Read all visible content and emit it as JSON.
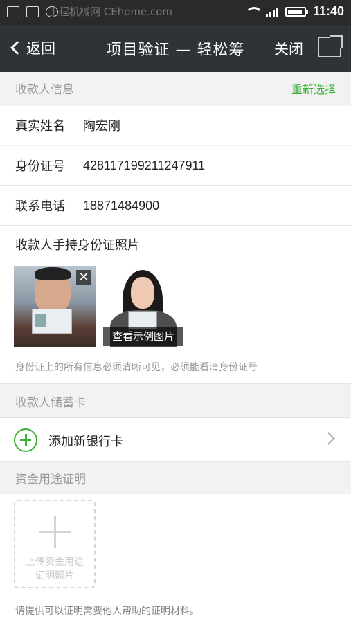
{
  "status_bar": {
    "time": "11:40",
    "watermark": "工程机械网 CEhome.com"
  },
  "nav": {
    "back_label": "返回",
    "title": "项目验证 — 轻松筹",
    "close_label": "关闭"
  },
  "payee_section": {
    "header": "收款人信息",
    "reselect_label": "重新选择",
    "fields": [
      {
        "label": "真实姓名",
        "value": "陶宏刚"
      },
      {
        "label": "身份证号",
        "value": "428117199211247911"
      },
      {
        "label": "联系电话",
        "value": "18871484900"
      }
    ]
  },
  "id_photo": {
    "title": "收款人手持身份证照片",
    "example_label": "查看示例图片",
    "close_symbol": "✕",
    "note": "身份证上的所有信息必须清晰可见，必须能看清身份证号"
  },
  "bank_section": {
    "header": "收款人储蓄卡",
    "add_label": "添加新银行卡"
  },
  "fund_section": {
    "header": "资金用途证明",
    "upload_line1": "上传资金用途",
    "upload_line2": "证明照片",
    "note": "请提供可以证明需要他人帮助的证明材料。"
  },
  "colors": {
    "accent_green": "#3bb23b",
    "nav_bg": "#2f3237"
  }
}
